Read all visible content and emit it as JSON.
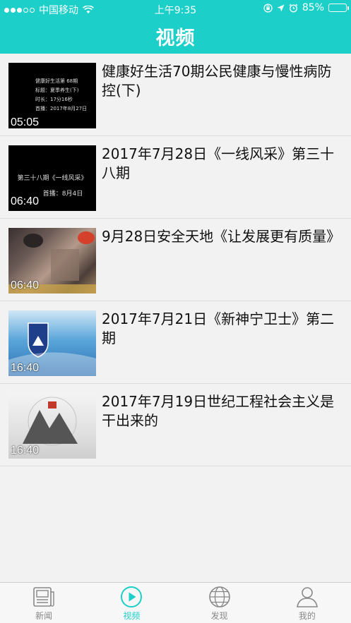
{
  "status_bar": {
    "carrier": "中国移动",
    "time": "上午9:35",
    "battery": "85%",
    "battery_level": 0.85
  },
  "header": {
    "title": "视频"
  },
  "videos": [
    {
      "title": "健康好生活70期公民健康与慢性病防控(下)",
      "duration": "05:05",
      "thumb_lines": [
        "健康好生活第 68期",
        "标题：夏季养生(下)",
        "时长：17分16秒",
        "首播：2017年8月27日"
      ]
    },
    {
      "title": "2017年7月28日《一线风采》第三十八期",
      "duration": "06:40",
      "thumb_lines": [
        "第三十八期《一线风采》",
        "首播：8月4日"
      ]
    },
    {
      "title": "9月28日安全天地《让发展更有质量》",
      "duration": "06:40"
    },
    {
      "title": "2017年7月21日《新神宁卫士》第二期",
      "duration": "16:40"
    },
    {
      "title": "2017年7月19日世纪工程社会主义是干出来的",
      "duration": "16:40"
    }
  ],
  "tabbar": {
    "items": [
      {
        "label": "新闻",
        "icon": "news-icon"
      },
      {
        "label": "视频",
        "icon": "play-icon",
        "active": true
      },
      {
        "label": "发现",
        "icon": "globe-icon"
      },
      {
        "label": "我的",
        "icon": "person-icon"
      }
    ]
  },
  "colors": {
    "accent": "#1ccfc9",
    "background": "#f2f2f2"
  }
}
